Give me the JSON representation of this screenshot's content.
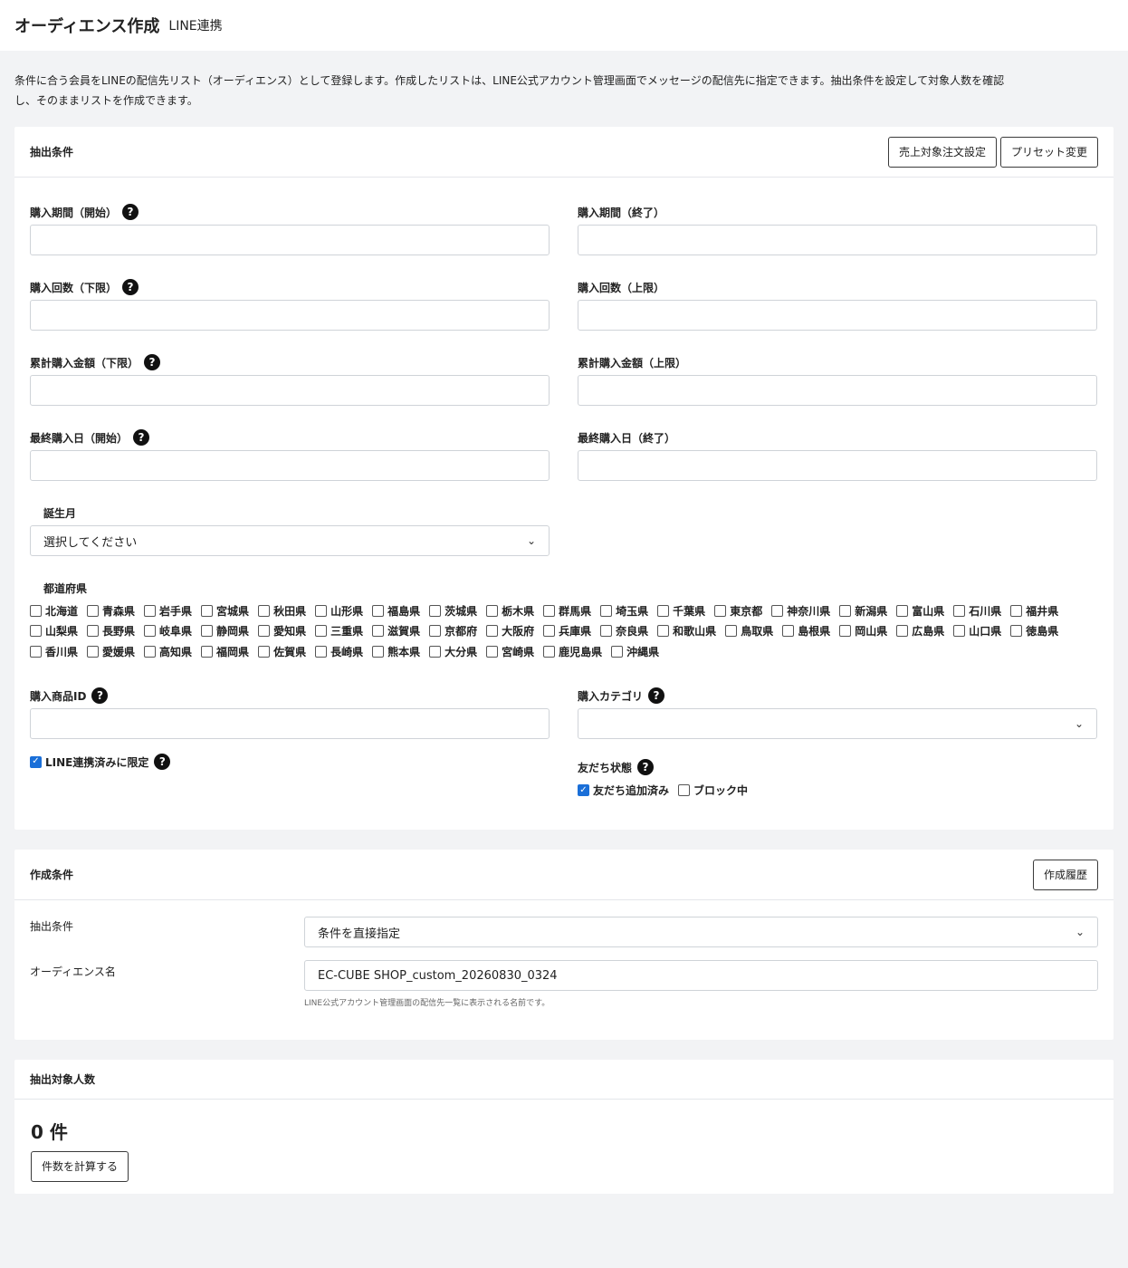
{
  "header": {
    "title": "オーディエンス作成",
    "subtitle": "LINE連携"
  },
  "intro": {
    "line1": "条件に合う会員をLINEの配信先リスト（オーディエンス）として登録します。作成したリストは、LINE公式アカウント管理画面でメッセージの配信先に指定できます。抽出条件を設定して対象人数を確認",
    "line2": "し、そのままリストを作成できます。"
  },
  "extract_card": {
    "title": "抽出条件",
    "btn_sales_target": "売上対象注文設定",
    "btn_preset": "プリセット変更",
    "fields": {
      "purchase_start": {
        "label": "購入期間（開始）",
        "value": ""
      },
      "purchase_end": {
        "label": "購入期間（終了）",
        "value": ""
      },
      "count_min": {
        "label": "購入回数（下限）",
        "value": ""
      },
      "count_max": {
        "label": "購入回数（上限）",
        "value": ""
      },
      "amount_min": {
        "label": "累計購入金額（下限）",
        "value": ""
      },
      "amount_max": {
        "label": "累計購入金額（上限）",
        "value": ""
      },
      "last_start": {
        "label": "最終購入日（開始）",
        "value": ""
      },
      "last_end": {
        "label": "最終購入日（終了）",
        "value": ""
      },
      "birth_month": {
        "label": "誕生月",
        "value": "選択してください"
      },
      "product_id": {
        "label": "購入商品ID",
        "value": ""
      },
      "category": {
        "label": "購入カテゴリ",
        "value": ""
      }
    },
    "prefecture_label": "都道府県",
    "prefectures": [
      "北海道",
      "青森県",
      "岩手県",
      "宮城県",
      "秋田県",
      "山形県",
      "福島県",
      "茨城県",
      "栃木県",
      "群馬県",
      "埼玉県",
      "千葉県",
      "東京都",
      "神奈川県",
      "新潟県",
      "富山県",
      "石川県",
      "福井県",
      "山梨県",
      "長野県",
      "岐阜県",
      "静岡県",
      "愛知県",
      "三重県",
      "滋賀県",
      "京都府",
      "大阪府",
      "兵庫県",
      "奈良県",
      "和歌山県",
      "鳥取県",
      "島根県",
      "岡山県",
      "広島県",
      "山口県",
      "徳島県",
      "香川県",
      "愛媛県",
      "高知県",
      "福岡県",
      "佐賀県",
      "長崎県",
      "熊本県",
      "大分県",
      "宮崎県",
      "鹿児島県",
      "沖縄県"
    ],
    "line_only": {
      "label": "LINE連携済みに限定",
      "checked": true
    },
    "friend_status": {
      "label": "友だち状態",
      "added": {
        "label": "友だち追加済み",
        "checked": true
      },
      "blocked": {
        "label": "ブロック中",
        "checked": false
      }
    },
    "help_glyph": "?"
  },
  "create_card": {
    "title": "作成条件",
    "btn_history": "作成履歴",
    "condition_label": "抽出条件",
    "condition_value": "条件を直接指定",
    "name_label": "オーディエンス名",
    "name_value": "EC-CUBE SHOP_custom_20260830_0324",
    "name_hint": "LINE公式アカウント管理画面の配信先一覧に表示される名前です。"
  },
  "count_card": {
    "title": "抽出対象人数",
    "value": "0 件",
    "btn_calc": "件数を計算する"
  },
  "icons": {
    "check": "✓",
    "chevron": "⌄"
  }
}
